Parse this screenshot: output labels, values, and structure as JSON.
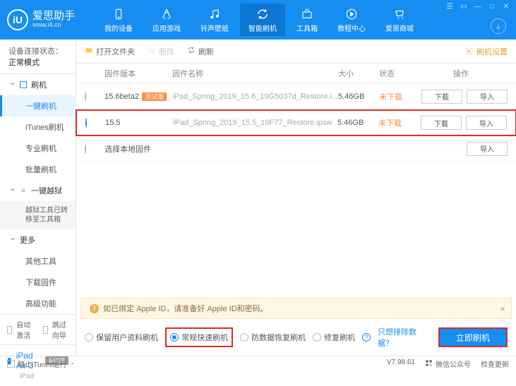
{
  "brand": {
    "name": "爱思助手",
    "url": "www.i4.cn",
    "logo_letter": "iU"
  },
  "nav": {
    "items": [
      {
        "label": "我的设备"
      },
      {
        "label": "应用游戏"
      },
      {
        "label": "铃声壁纸"
      },
      {
        "label": "智能刷机"
      },
      {
        "label": "工具箱"
      },
      {
        "label": "教程中心"
      },
      {
        "label": "爱思商城"
      }
    ]
  },
  "sidebar": {
    "conn_label": "设备连接状态：",
    "conn_value": "正常模式",
    "flash": "刷机",
    "flash_children": [
      "一键刷机",
      "iTunes刷机",
      "专业刷机",
      "批量刷机"
    ],
    "jailbreak": "一键越狱",
    "jailbreak_moved": "越狱工具已转移至工具箱",
    "more": "更多",
    "more_children": [
      "其他工具",
      "下载固件",
      "高级功能"
    ],
    "auto_activate": "自动激活",
    "skip_guide": "跳过向导",
    "device": {
      "name": "iPad Air 3",
      "storage": "64GB",
      "type": "iPad"
    }
  },
  "toolbar": {
    "open_folder": "打开文件夹",
    "delete": "删除",
    "refresh": "刷新",
    "settings": "刷机设置"
  },
  "table": {
    "head": {
      "version": "固件版本",
      "name": "固件名称",
      "size": "大小",
      "status": "状态",
      "ops": "操作"
    },
    "rows": [
      {
        "version": "15.6beta2",
        "beta": "测试版",
        "name": "iPad_Spring_2019_15.6_19G5037d_Restore.i...",
        "size": "5.46GB",
        "status": "未下载",
        "checked": false
      },
      {
        "version": "15.5",
        "beta": "",
        "name": "iPad_Spring_2019_15.5_19F77_Restore.ipsw",
        "size": "5.46GB",
        "status": "未下载",
        "checked": true
      }
    ],
    "local_firmware": "选择本地固件",
    "btn_download": "下载",
    "btn_import": "导入"
  },
  "alert": {
    "text": "如已绑定 Apple ID，请准备好 Apple ID和密码。"
  },
  "options": {
    "keep_data": "保留用户资料刷机",
    "normal_fast": "常规快速刷机",
    "anti_recovery": "防数据恢复刷机",
    "repair": "修复刷机",
    "exclude_link": "只想排除数据？",
    "flash_now": "立即刷机"
  },
  "statusbar": {
    "block_itunes": "阻止iTunes运行",
    "version": "V7.98.61",
    "wechat": "微信公众号",
    "check_update": "检查更新"
  }
}
